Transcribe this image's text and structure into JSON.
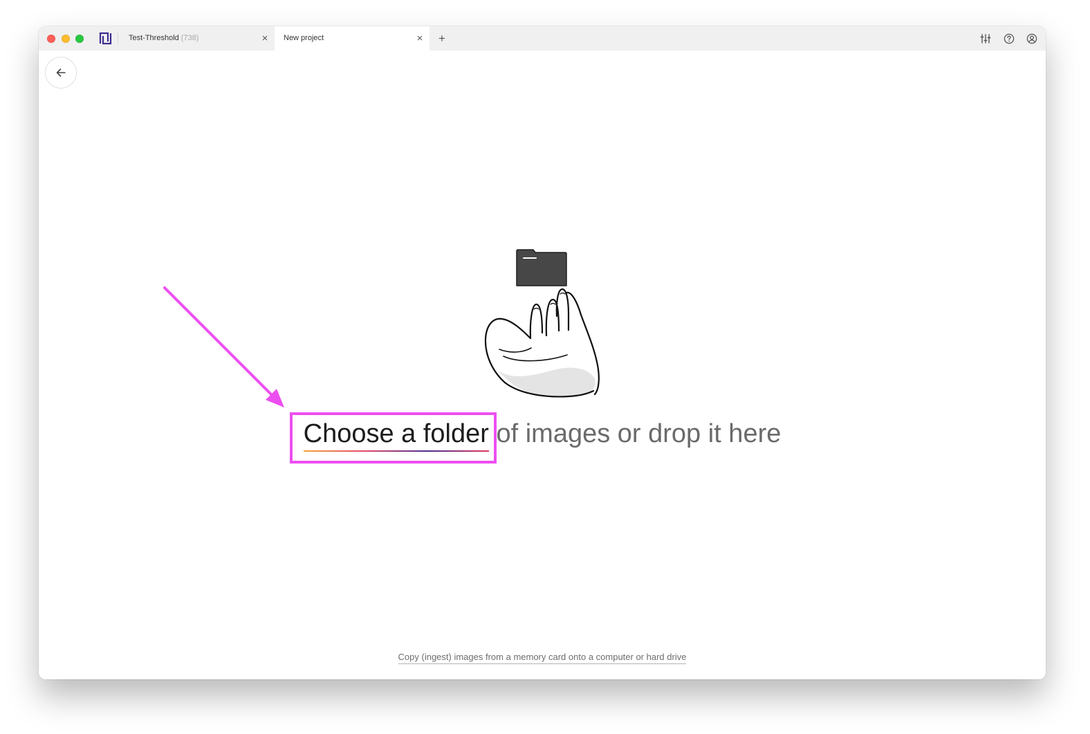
{
  "window": {
    "traffic_lights": {
      "close": "#ff5f57",
      "minimize": "#febc2e",
      "zoom": "#28c840"
    }
  },
  "app": {
    "logo_icon": "narrative-logo-icon",
    "brand_color": "#3b2d8f"
  },
  "tabs": [
    {
      "label": "Test-Threshold",
      "count": "(738)",
      "close": "×",
      "active": false
    },
    {
      "label": "New project",
      "close": "×",
      "active": true
    }
  ],
  "new_tab": {
    "label": "+"
  },
  "toolbar_icons": [
    "sliders-icon",
    "help-icon",
    "account-icon"
  ],
  "back_button": {
    "icon": "arrow-left-icon"
  },
  "dropzone": {
    "illustration_icon": "hand-holding-folder-icon",
    "choose_link": "Choose a folder",
    "rest_text": "of images or drop it here",
    "underline_colors": [
      "#f4a33c",
      "#e2486a",
      "#4b2b8f",
      "#e2375a"
    ]
  },
  "footer_link": "Copy (ingest) images from a memory card onto a computer or hard drive",
  "annotation": {
    "color": "#ec4ff0"
  }
}
